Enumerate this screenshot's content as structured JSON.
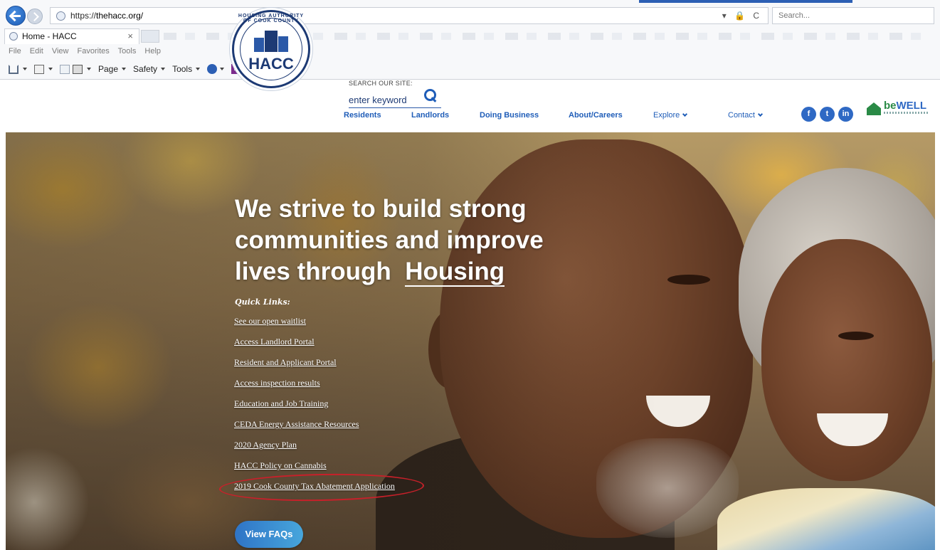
{
  "browser": {
    "url_scheme": "https://",
    "url_host": "thehacc.org/",
    "url_icons": "▾ 🔒 C",
    "search_placeholder": "Search...",
    "tab_title": "Home - HACC",
    "tab_close": "×",
    "menu": [
      "File",
      "Edit",
      "View",
      "Favorites",
      "Tools",
      "Help"
    ],
    "commands": {
      "page": "Page",
      "safety": "Safety",
      "tools": "Tools",
      "onenote_1": "N",
      "onenote_2": "N"
    }
  },
  "site": {
    "logo_ring_text": "HOUSING AUTHORITY OF COOK COUNTY",
    "logo_text": "HACC",
    "search_label": "SEARCH OUR SITE:",
    "search_placeholder": "enter keyword",
    "nav": [
      {
        "label": "Residents"
      },
      {
        "label": "Landlords"
      },
      {
        "label": "Doing Business"
      },
      {
        "label": "About/Careers"
      },
      {
        "label": "Explore"
      },
      {
        "label": "Contact"
      }
    ],
    "social": [
      "f",
      "t",
      "in"
    ],
    "bewell": {
      "be": "be",
      "well": "WELL"
    }
  },
  "hero": {
    "headline_line1": "We strive to build strong",
    "headline_line2": "communities and improve",
    "headline_line3_prefix": "lives through",
    "headline_highlight": "Housing",
    "quick_links_title": "Quick Links:",
    "quick_links": [
      "See our open waitlist",
      "Access Landlord Portal",
      "Resident and Applicant Portal",
      "Access inspection results",
      "Education and Job Training",
      "CEDA Energy Assistance Resources",
      "2020 Agency Plan",
      "HACC Policy on Cannabis",
      "2019 Cook County Tax Abatement Application"
    ],
    "faq_button": "View FAQs"
  },
  "colors": {
    "brand_blue": "#1f5db8",
    "annotation_red": "#c8202a",
    "bewell_green": "#2a8a46"
  }
}
